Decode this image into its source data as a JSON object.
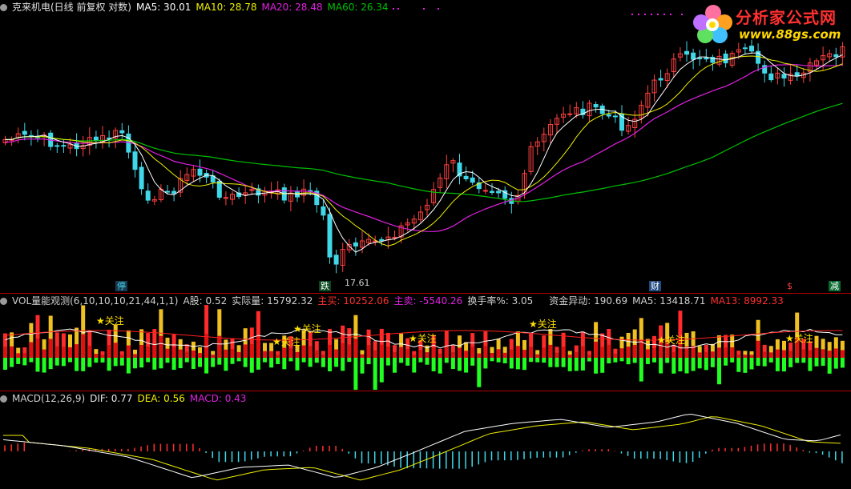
{
  "main_header": {
    "title": "克来机电(日线 前复权 对数)",
    "ma5": "MA5: 30.01",
    "ma10": "MA10: 28.78",
    "ma20": "MA20: 28.48",
    "ma60": "MA60: 26.34"
  },
  "markers": {
    "stop": "停",
    "fall": "跌",
    "finance": "财",
    "dollar": "$",
    "reduce": "减",
    "low_price": "17.61"
  },
  "vol_header": {
    "title": "VOL量能观测(6,10,10,10,21,44,1,1)",
    "a_shares": "A股: 0.52",
    "actual_volume": "实际量: 15792.32",
    "main_buy": "主买: 10252.06",
    "main_sell": "主卖: -5540.26",
    "turnover": "换手率%: 3.05",
    "fund_anomaly": "资金异动: 190.69",
    "ma5": "MA5: 13418.71",
    "ma13": "MA13: 8992.33"
  },
  "attention_label": "关注",
  "macd_header": {
    "title": "MACD(12,26,9)",
    "dif": "DIF: 0.77",
    "dea": "DEA: 0.56",
    "macd": "MACD: 0.43"
  },
  "logo": {
    "title": "分析家公式网",
    "url": "www.88gs.com"
  },
  "colors": {
    "up": "#ff4040",
    "down": "#40d8e8",
    "ma5": "#ffffff",
    "ma10": "#f0f000",
    "ma20": "#e020e0",
    "ma60": "#00c000"
  }
}
